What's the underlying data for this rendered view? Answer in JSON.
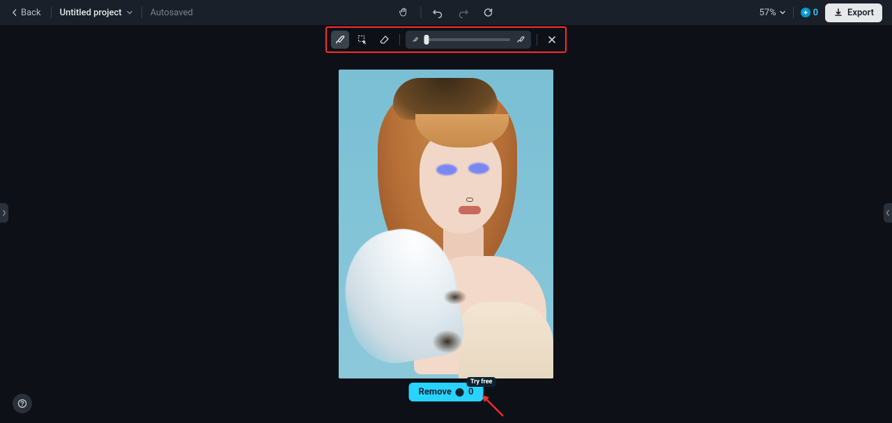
{
  "header": {
    "back_label": "Back",
    "project_name": "Untitled project",
    "autosaved_label": "Autosaved",
    "zoom_text": "57%",
    "credits_value": "0",
    "export_label": "Export"
  },
  "toolbar": {
    "brush_tool": "brush",
    "box_tool": "box-select",
    "eraser_tool": "eraser",
    "size_small_icon": "small-brush",
    "size_large_icon": "large-brush",
    "close_label": "close"
  },
  "action": {
    "remove_label": "Remove",
    "try_free_label": "Try free",
    "cost_value": "0"
  },
  "help": {
    "label": "?"
  }
}
